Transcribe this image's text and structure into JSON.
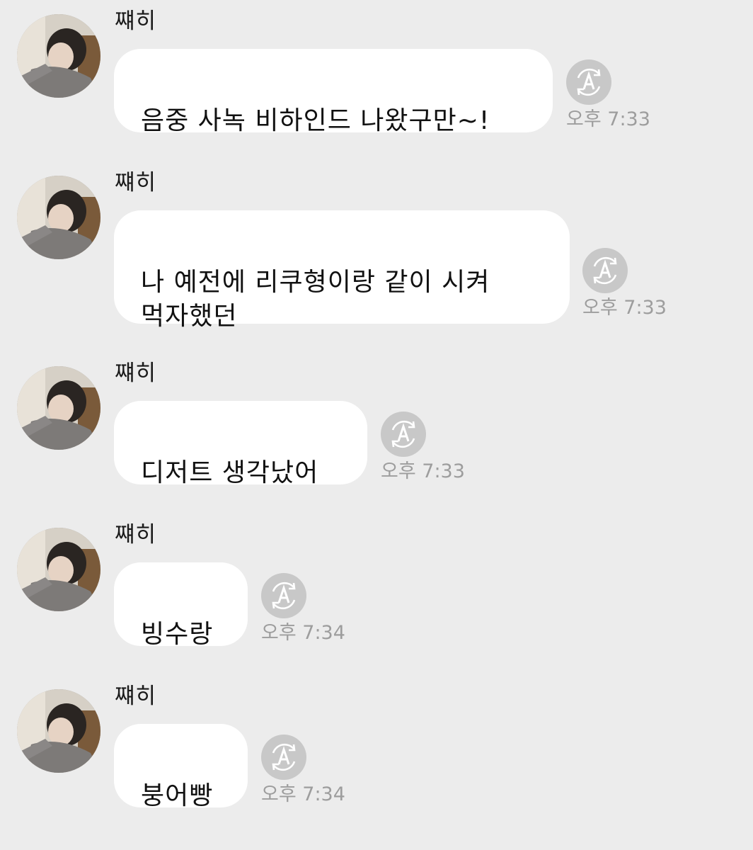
{
  "chat": {
    "messages": [
      {
        "sender": "쨰히",
        "text": "음중 사녹 비하인드 나왔구만~!",
        "time": "오후 7:33"
      },
      {
        "sender": "쨰히",
        "text": "나 예전에 리쿠형이랑 같이 시켜\n먹자했던",
        "time": "오후 7:33"
      },
      {
        "sender": "쨰히",
        "text": "디저트 생각났어",
        "time": "오후 7:33"
      },
      {
        "sender": "쨰히",
        "text": "빙수랑",
        "time": "오후 7:34"
      },
      {
        "sender": "쨰히",
        "text": "붕어빵",
        "time": "오후 7:34"
      }
    ]
  },
  "icons": {
    "avatar": "profile-photo",
    "translate": "auto-translate-icon"
  },
  "colors": {
    "background": "#ececec",
    "bubble": "#ffffff",
    "timestamp": "#9d9d9d",
    "icon": "#c8c8c8"
  }
}
